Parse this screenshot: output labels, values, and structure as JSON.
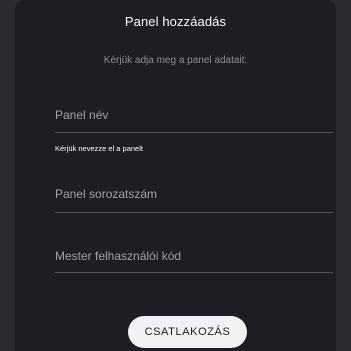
{
  "dialog": {
    "title": "Panel hozzáadás",
    "subtitle": "Kérjük adja meg a panel adatait:"
  },
  "form": {
    "panel_name": {
      "label": "Panel név",
      "helper": "Kérjük nevezze el a panelt"
    },
    "panel_serial": {
      "label": "Panel sorozatszám"
    },
    "master_code": {
      "label": "Mester felhasználói kód"
    }
  },
  "actions": {
    "connect_label": "CSATLAKOZÁS"
  }
}
